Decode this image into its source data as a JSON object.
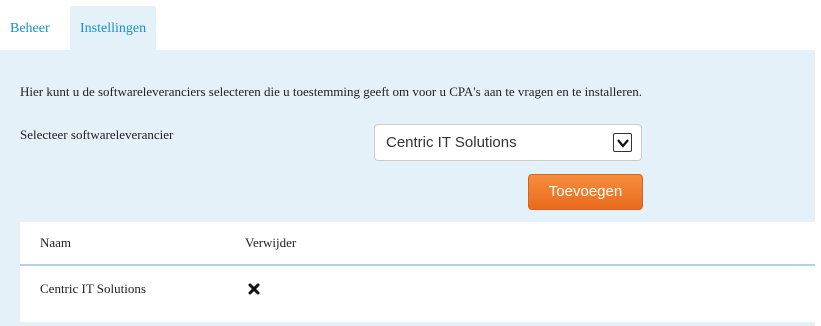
{
  "tabs": [
    {
      "label": "Beheer",
      "active": false
    },
    {
      "label": "Instellingen",
      "active": true
    }
  ],
  "intro_text": "Hier kunt u de softwareleveranciers selecteren die u toestemming geeft om voor u CPA's aan te vragen en te installeren.",
  "select": {
    "label": "Selecteer softwareleverancier",
    "value": "Centric IT Solutions"
  },
  "add_button_label": "Toevoegen",
  "table": {
    "headers": {
      "name": "Naam",
      "delete": "Verwijder"
    },
    "rows": [
      {
        "name": "Centric IT Solutions",
        "delete_icon": "close-x-icon"
      }
    ]
  },
  "colors": {
    "tab_text": "#1a8fd0",
    "panel_bg": "#e4f1f9",
    "button_orange": "#f07a2a",
    "header_border": "#aed4ec"
  }
}
